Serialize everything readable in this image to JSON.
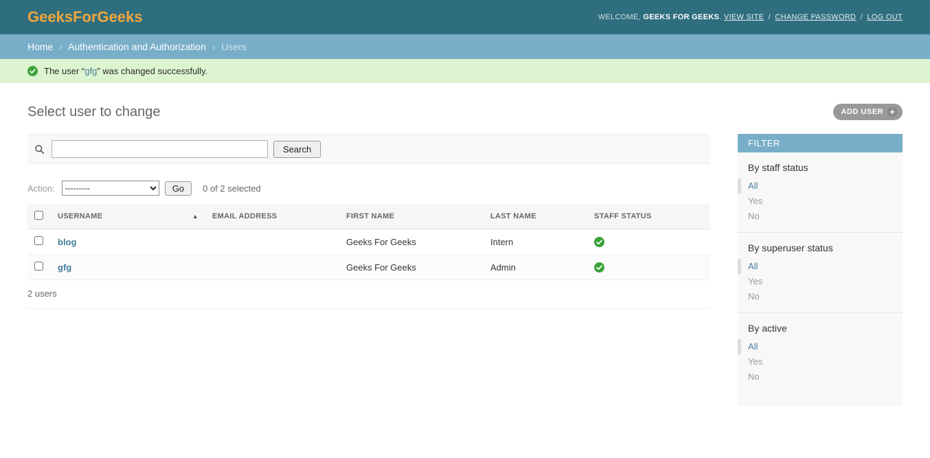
{
  "colors": {
    "header_bg": "#2f6e7e",
    "brand_text": "#f0a63c",
    "breadcrumbs_bg": "#79aec8",
    "link": "#447e9b",
    "success_bg": "#ddf4d0",
    "success_green": "#3aa23a",
    "filter_header_bg": "#79aec8",
    "add_button_bg": "#999999"
  },
  "header": {
    "brand": "GeeksForGeeks",
    "welcome_prefix": "WELCOME,",
    "username": "GEEKS FOR GEEKS",
    "period": ".",
    "separator": "/",
    "links": [
      {
        "label": "VIEW SITE"
      },
      {
        "label": "CHANGE PASSWORD"
      },
      {
        "label": "LOG OUT"
      }
    ]
  },
  "breadcrumbs": {
    "divider": "›",
    "items": [
      {
        "label": "Home"
      },
      {
        "label": "Authentication and Authorization"
      },
      {
        "label": "Users"
      }
    ]
  },
  "message": {
    "text_before": "The user “",
    "object": "gfg",
    "text_after": "” was changed successfully."
  },
  "page": {
    "title": "Select user to change",
    "add_button": "ADD USER"
  },
  "toolbar": {
    "search_value": "",
    "search_button": "Search"
  },
  "actions": {
    "label": "Action:",
    "selected_option": "---------",
    "go_button": "Go",
    "counter": "0 of 2 selected"
  },
  "table": {
    "headers": [
      "USERNAME",
      "EMAIL ADDRESS",
      "FIRST NAME",
      "LAST NAME",
      "STAFF STATUS"
    ],
    "sort_indicator": "▲",
    "rows": [
      {
        "username": "blog",
        "email": "",
        "first_name": "Geeks For Geeks",
        "last_name": "Intern",
        "staff_status": true
      },
      {
        "username": "gfg",
        "email": "",
        "first_name": "Geeks For Geeks",
        "last_name": "Admin",
        "staff_status": true
      }
    ],
    "summary": "2 users"
  },
  "filter": {
    "title": "FILTER",
    "sections": [
      {
        "heading": "By staff status",
        "options": [
          {
            "label": "All",
            "selected": true
          },
          {
            "label": "Yes",
            "selected": false
          },
          {
            "label": "No",
            "selected": false
          }
        ]
      },
      {
        "heading": "By superuser status",
        "options": [
          {
            "label": "All",
            "selected": true
          },
          {
            "label": "Yes",
            "selected": false
          },
          {
            "label": "No",
            "selected": false
          }
        ]
      },
      {
        "heading": "By active",
        "options": [
          {
            "label": "All",
            "selected": true
          },
          {
            "label": "Yes",
            "selected": false
          },
          {
            "label": "No",
            "selected": false
          }
        ]
      }
    ]
  }
}
